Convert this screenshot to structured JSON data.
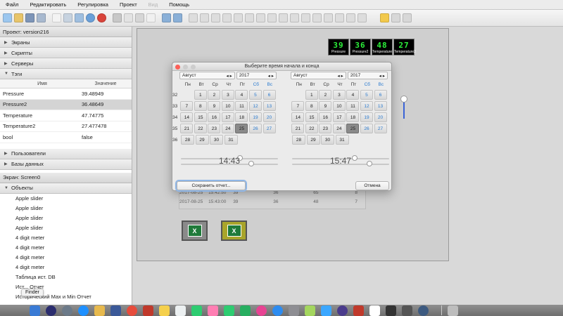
{
  "menu": [
    "Файл",
    "Редактировать",
    "Регулировка",
    "Проект",
    "Вид",
    "Помощь"
  ],
  "left": {
    "project_title": "Проект: version216",
    "sections": [
      "Экраны",
      "Скрипты",
      "Серверы",
      "Тэги"
    ],
    "tags_header": {
      "name": "Имя",
      "value": "Значение"
    },
    "tags": [
      {
        "name": "Pressure",
        "value": "39.48949"
      },
      {
        "name": "Pressure2",
        "value": "36.48649"
      },
      {
        "name": "Temperature",
        "value": "47.74775"
      },
      {
        "name": "Temperature2",
        "value": "27.477478"
      },
      {
        "name": "bool",
        "value": "false"
      }
    ],
    "sections2": [
      "Пользователи",
      "Базы данных"
    ],
    "screen_title": "Экран: Screen0",
    "objects_label": "Объекты",
    "objects": [
      "Apple slider",
      "Apple slider",
      "Apple slider",
      "Apple slider",
      "4 digit meter",
      "4 digit meter",
      "4 digit meter",
      "4 digit meter",
      "Таблица ист. DB",
      "Ист... Отчет",
      "Исторический Max и Min Отчет"
    ]
  },
  "meters": [
    {
      "value": "39",
      "label": "Pressure"
    },
    {
      "value": "36",
      "label": "Pressure2"
    },
    {
      "value": "48",
      "label": "Temperature"
    },
    {
      "value": "27",
      "label": "Temperature2"
    }
  ],
  "dialog": {
    "title": "Выберите время начала и конца",
    "left_cal": {
      "month": "Август",
      "year": "2017",
      "time": "14:43"
    },
    "right_cal": {
      "month": "Август",
      "year": "2017",
      "time": "15:47"
    },
    "day_headers": [
      "Пн",
      "Вт",
      "Ср",
      "Чт",
      "Пт",
      "Сб",
      "Вс"
    ],
    "week_numbers": [
      "32",
      "33",
      "34",
      "35",
      "36"
    ],
    "save_button": "Сохранить отчет...",
    "cancel_button": "Отмена"
  },
  "bg_rows": [
    {
      "c1": "2017-08-25",
      "c2": "15:42:50",
      "c3": "39",
      "c4": "36",
      "c5": "65",
      "c6": "8"
    },
    {
      "c1": "2017-08-25",
      "c2": "15:43:00",
      "c3": "39",
      "c4": "36",
      "c5": "48",
      "c6": "7"
    }
  ],
  "tooltip": "Finder"
}
